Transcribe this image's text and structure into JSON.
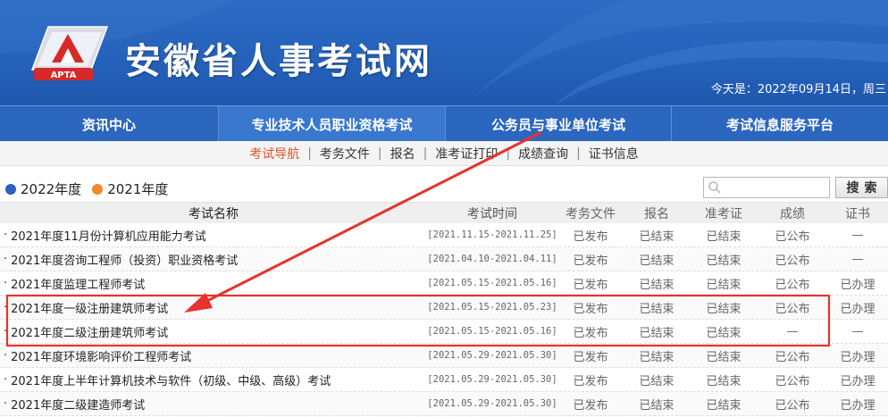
{
  "site": {
    "title": "安徽省人事考试网",
    "logo_text": "APTA",
    "today_label": "今天是：",
    "today_date": "2022年09月14日，周三"
  },
  "mainnav": [
    {
      "label": "资讯中心"
    },
    {
      "label": "专业技术人员职业资格考试"
    },
    {
      "label": "公务员与事业单位考试"
    },
    {
      "label": "考试信息服务平台"
    }
  ],
  "subnav": [
    {
      "label": "考试导航"
    },
    {
      "label": "考务文件"
    },
    {
      "label": "报名"
    },
    {
      "label": "准考证打印"
    },
    {
      "label": "成绩查询"
    },
    {
      "label": "证书信息"
    }
  ],
  "years": [
    {
      "label": "2022年度",
      "color": "#2b5fc0"
    },
    {
      "label": "2021年度",
      "color": "#f18a2b"
    }
  ],
  "search": {
    "placeholder": "",
    "button": "搜索"
  },
  "table": {
    "headers": [
      "考试名称",
      "考试时间",
      "考务文件",
      "报名",
      "准考证",
      "成绩",
      "证书"
    ],
    "rows": [
      [
        "2021年度11月份计算机应用能力考试",
        "[2021.11.15-2021.11.25]",
        "已发布",
        "已结束",
        "已结束",
        "已公布",
        "—"
      ],
      [
        "2021年度咨询工程师（投资）职业资格考试",
        "[2021.04.10-2021.04.11]",
        "已发布",
        "已结束",
        "已结束",
        "已公布",
        "—"
      ],
      [
        "2021年度监理工程师考试",
        "[2021.05.15-2021.05.16]",
        "已发布",
        "已结束",
        "已结束",
        "已公布",
        "已办理"
      ],
      [
        "2021年度一级注册建筑师考试",
        "[2021.05.15-2021.05.23]",
        "已发布",
        "已结束",
        "已结束",
        "已公布",
        "已办理"
      ],
      [
        "2021年度二级注册建筑师考试",
        "[2021.05.15-2021.05.16]",
        "已发布",
        "已结束",
        "已结束",
        "—",
        "—"
      ],
      [
        "2021年度环境影响评价工程师考试",
        "[2021.05.29-2021.05.30]",
        "已发布",
        "已结束",
        "已结束",
        "已公布",
        "已办理"
      ],
      [
        "2021年度上半年计算机技术与软件（初级、中级、高级）考试",
        "[2021.05.29-2021.05.30]",
        "已发布",
        "已结束",
        "已结束",
        "已公布",
        "已办理"
      ],
      [
        "2021年度二级建造师考试",
        "[2021.05.29-2021.05.30]",
        "已发布",
        "已结束",
        "已结束",
        "已公布",
        "已办理"
      ]
    ]
  },
  "colors": {
    "header_blue": "#2562bb",
    "nav_blue": "#2b66bf",
    "active_sub": "#e0542a",
    "annotation_red": "#e8322d"
  }
}
